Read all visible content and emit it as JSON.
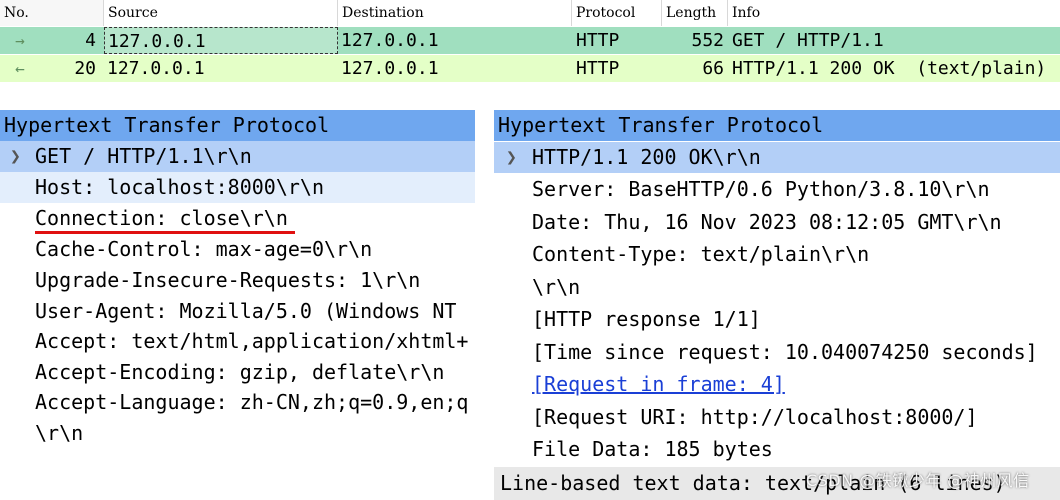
{
  "packet_list": {
    "columns": {
      "no": "No.",
      "source": "Source",
      "destination": "Destination",
      "protocol": "Protocol",
      "length": "Length",
      "info": "Info"
    },
    "rows": [
      {
        "arrow": "→",
        "no": "4",
        "source": "127.0.0.1",
        "destination": "127.0.0.1",
        "protocol": "HTTP",
        "length": "552",
        "info": "GET / HTTP/1.1"
      },
      {
        "arrow": "←",
        "no": "20",
        "source": "127.0.0.1",
        "destination": "127.0.0.1",
        "protocol": "HTTP",
        "length": "66",
        "info": "HTTP/1.1 200 OK  (text/plain)"
      }
    ]
  },
  "request_pane": {
    "title": "Hypertext Transfer Protocol",
    "request_line": "GET / HTTP/1.1\\r\\n",
    "headers": [
      "Host: localhost:8000\\r\\n",
      "Connection: close\\r\\n",
      "Cache-Control: max-age=0\\r\\n",
      "Upgrade-Insecure-Requests: 1\\r\\n",
      "User-Agent: Mozilla/5.0 (Windows NT",
      "Accept: text/html,application/xhtml+",
      "Accept-Encoding: gzip, deflate\\r\\n",
      "Accept-Language: zh-CN,zh;q=0.9,en;q",
      "\\r\\n"
    ]
  },
  "response_pane": {
    "title": "Hypertext Transfer Protocol",
    "status_line": "HTTP/1.1 200 OK\\r\\n",
    "headers": [
      "Server: BaseHTTP/0.6 Python/3.8.10\\r\\n",
      "Date: Thu, 16 Nov 2023 08:12:05 GMT\\r\\n",
      "Content-Type: text/plain\\r\\n",
      "\\r\\n",
      "[HTTP response 1/1]",
      "[Time since request: 10.040074250 seconds]"
    ],
    "request_link": "[Request in frame: 4]",
    "extra": [
      "[Request URI: http://localhost:8000/]",
      "File Data: 185 bytes"
    ],
    "bottom": "Line-based text data: text/plain (6 lines)"
  },
  "watermark": "CSDN @铁锹少年 @神州风信",
  "icons": {
    "expand": "chevron-right-icon",
    "direction_out": "arrow-right-icon",
    "direction_in": "arrow-left-icon"
  },
  "colors": {
    "request_row": "#a0dfbf",
    "response_row": "#e4ffc7",
    "protocol_header": "#6fa7ef",
    "selected_subtree": "#b3cff7",
    "highlight_underline": "#e01010",
    "link": "#1a3fd6"
  }
}
